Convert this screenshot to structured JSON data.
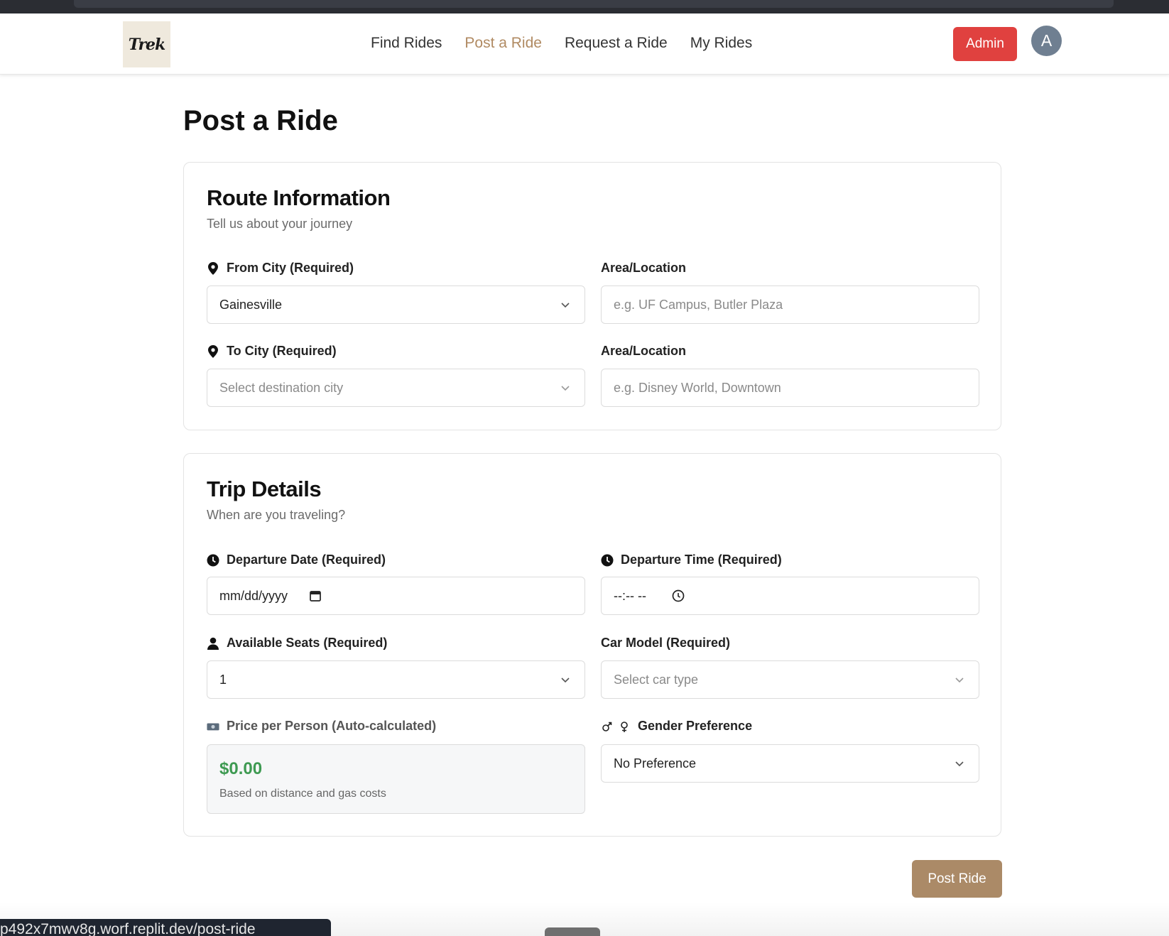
{
  "nav": {
    "logo_text": "Trek",
    "links": [
      "Find Rides",
      "Post a Ride",
      "Request a Ride",
      "My Rides"
    ],
    "active_index": 1,
    "admin_label": "Admin",
    "avatar_initial": "A"
  },
  "page": {
    "title": "Post a Ride"
  },
  "route": {
    "title": "Route Information",
    "subtitle": "Tell us about your journey",
    "from_label": "From City (Required)",
    "from_value": "Gainesville",
    "from_area_label": "Area/Location",
    "from_area_placeholder": "e.g. UF Campus, Butler Plaza",
    "to_label": "To City (Required)",
    "to_placeholder": "Select destination city",
    "to_area_label": "Area/Location",
    "to_area_placeholder": "e.g. Disney World, Downtown"
  },
  "trip": {
    "title": "Trip Details",
    "subtitle": "When are you traveling?",
    "date_label": "Departure Date (Required)",
    "date_placeholder": "mm/dd/yyyy",
    "time_label": "Departure Time (Required)",
    "time_placeholder": "--:-- --",
    "seats_label": "Available Seats (Required)",
    "seats_value": "1",
    "car_label": "Car Model (Required)",
    "car_placeholder": "Select car type",
    "price_label": "Price per Person (Auto-calculated)",
    "price_value": "$0.00",
    "price_note": "Based on distance and gas costs",
    "gender_label": "Gender Preference",
    "gender_value": "No Preference"
  },
  "actions": {
    "post_label": "Post Ride"
  },
  "status": {
    "url_text": "p492x7mwv8g.worf.replit.dev/post-ride"
  },
  "colors": {
    "accent": "#ab8a67",
    "active_nav": "#b08a62",
    "admin": "#e0413f",
    "price": "#3e9a52"
  }
}
